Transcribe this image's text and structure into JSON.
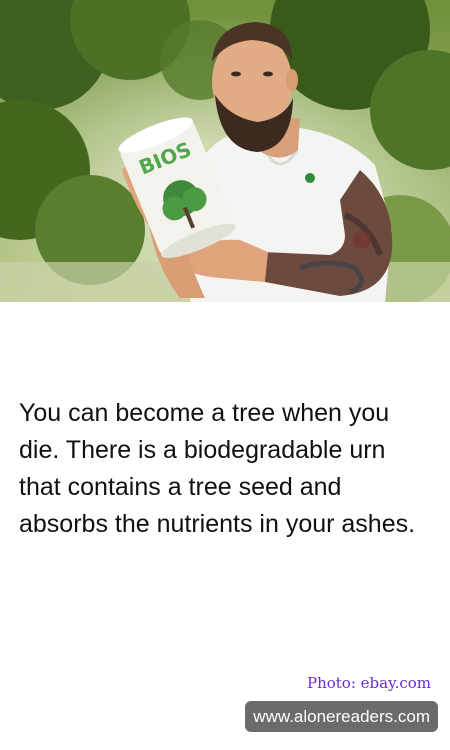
{
  "photo": {
    "urn_label": "BIOS"
  },
  "fact": {
    "text": "You can become a tree when you die. There is a biodegradable urn that contains a tree seed and absorbs the nutrients in your ashes."
  },
  "credit": {
    "text": "Photo: ebay.com"
  },
  "site": {
    "url": "www.alonereaders.com"
  },
  "colors": {
    "credit": "#6a2bd6",
    "badge_background": "#6b6b6b",
    "badge_text": "#ffffff",
    "body_text": "#111111"
  }
}
